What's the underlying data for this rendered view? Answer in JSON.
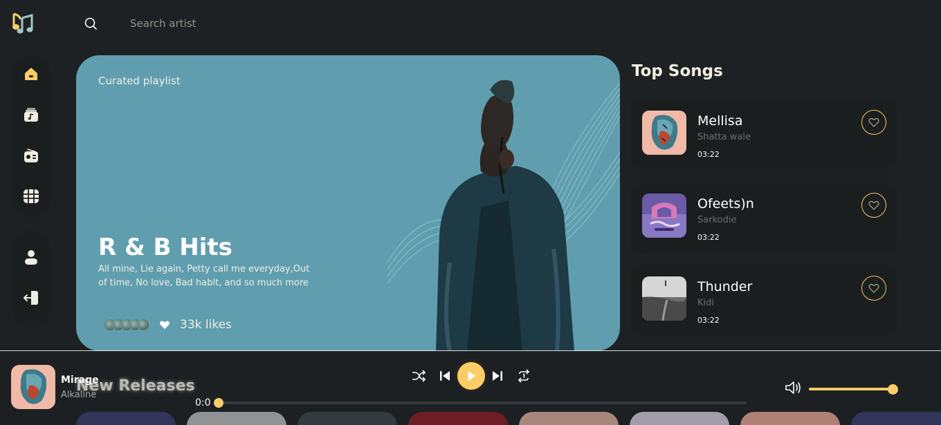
{
  "colors": {
    "background": "#1d2123",
    "accent": "#facd66",
    "hero_bg": "#609eaf",
    "card_bg": "#1a1e1f"
  },
  "header": {
    "logo_icon": "music-notes-icon",
    "search_icon": "search-icon",
    "search_placeholder": "Search artist"
  },
  "sidebar": {
    "main_items": [
      {
        "name": "home",
        "icon": "home-icon",
        "active": true
      },
      {
        "name": "playlist",
        "icon": "music-library-icon",
        "active": false
      },
      {
        "name": "radio",
        "icon": "radio-icon",
        "active": false
      },
      {
        "name": "videos",
        "icon": "videos-icon",
        "active": false
      }
    ],
    "account_items": [
      {
        "name": "profile",
        "icon": "user-icon"
      },
      {
        "name": "logout",
        "icon": "logout-icon"
      }
    ]
  },
  "hero": {
    "label": "Curated playlist",
    "title": "R & B Hits",
    "description": "All mine, Lie again, Petty call me everyday,Out of time, No love, Bad habit, and so much more",
    "likes": "33k likes",
    "listener_avatar_count": 5
  },
  "top_songs": {
    "title": "Top Songs",
    "items": [
      {
        "title": "Mellisa",
        "artist": "Shatta wale",
        "duration": "03:22"
      },
      {
        "title": "Ofeets)n",
        "artist": "Sarkodie",
        "duration": "03:22"
      },
      {
        "title": "Thunder",
        "artist": "Kidi",
        "duration": "03:22"
      }
    ]
  },
  "new_releases": {
    "title": "New Releases",
    "tile_colors": [
      "#3a3d6b",
      "#b8b8b8",
      "#3b4448",
      "#8a1c24",
      "#d9a89a",
      "#cfc8d6",
      "#e0a190",
      "#3a3d6b"
    ]
  },
  "player": {
    "track_title": "Mirage",
    "track_artist": "Alkaline",
    "current_time": "0:0",
    "progress": 0,
    "volume": 0.95,
    "controls": [
      "shuffle-icon",
      "previous-icon",
      "play-icon",
      "next-icon",
      "repeat-one-icon",
      "volume-icon"
    ]
  }
}
